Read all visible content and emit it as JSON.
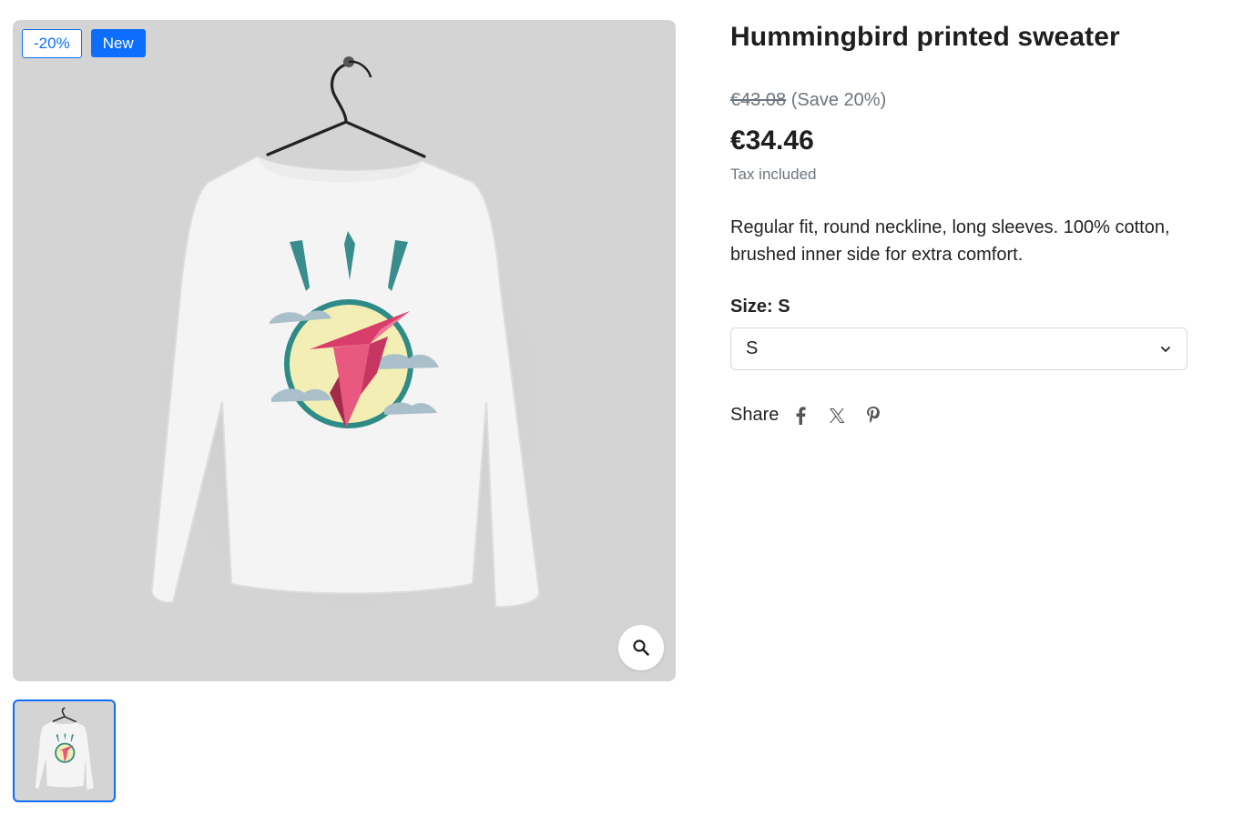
{
  "gallery": {
    "badges": {
      "discount": "-20%",
      "new": "New"
    },
    "zoom_icon": "search-icon",
    "thumbnail_count": 1
  },
  "product": {
    "title": "Hummingbird printed sweater",
    "regular_price": "€43.08",
    "save_text": "(Save 20%)",
    "price": "€34.46",
    "tax_note": "Tax included",
    "description": "Regular fit, round neckline, long sleeves. 100% cotton, brushed inner side for extra comfort.",
    "size_label": "Size: S",
    "size_selected": "S"
  },
  "share": {
    "label": "Share",
    "icons": [
      "facebook-icon",
      "x-icon",
      "pinterest-icon"
    ]
  },
  "colors": {
    "accent": "#0d6efd",
    "image_bg": "#d4d4d4",
    "muted_text": "#6c757d"
  }
}
